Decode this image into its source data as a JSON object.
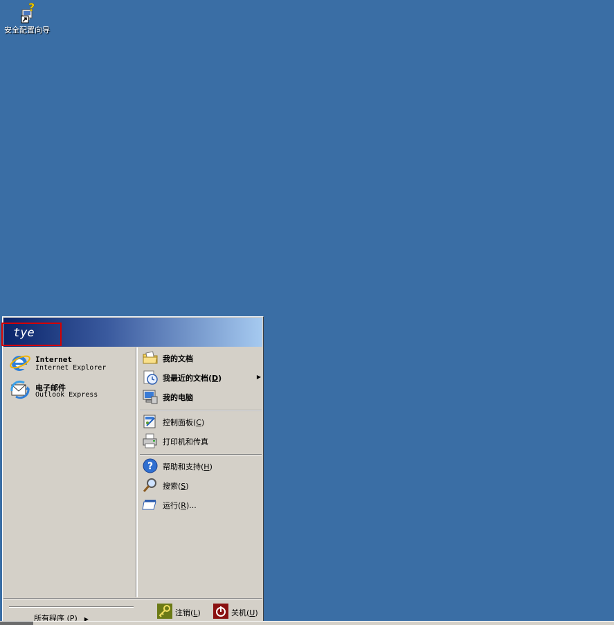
{
  "desktop": {
    "icons": [
      {
        "label": "安全配置向导",
        "icon": "security-wizard-icon"
      }
    ],
    "background": "#3a6ea5"
  },
  "start_menu": {
    "user": "tye",
    "pinned": [
      {
        "title": "Internet",
        "subtitle": "Internet Explorer",
        "icon": "internet-explorer-icon"
      },
      {
        "title": "电子邮件",
        "subtitle": "Outlook Express",
        "icon": "outlook-express-icon"
      }
    ],
    "all_programs": "所有程序",
    "all_programs_key": "P",
    "right": {
      "my_documents": "我的文档",
      "recent_documents": "我最近的文档",
      "recent_documents_key": "D",
      "my_computer": "我的电脑",
      "control_panel": "控制面板",
      "control_panel_key": "C",
      "printers": "打印机和传真",
      "help": "帮助和支持",
      "help_key": "H",
      "search": "搜索",
      "search_key": "S",
      "run": "运行",
      "run_key": "R",
      "run_suffix": "..."
    },
    "footer": {
      "logoff": "注销",
      "logoff_key": "L",
      "shutdown": "关机",
      "shutdown_key": "U"
    }
  }
}
